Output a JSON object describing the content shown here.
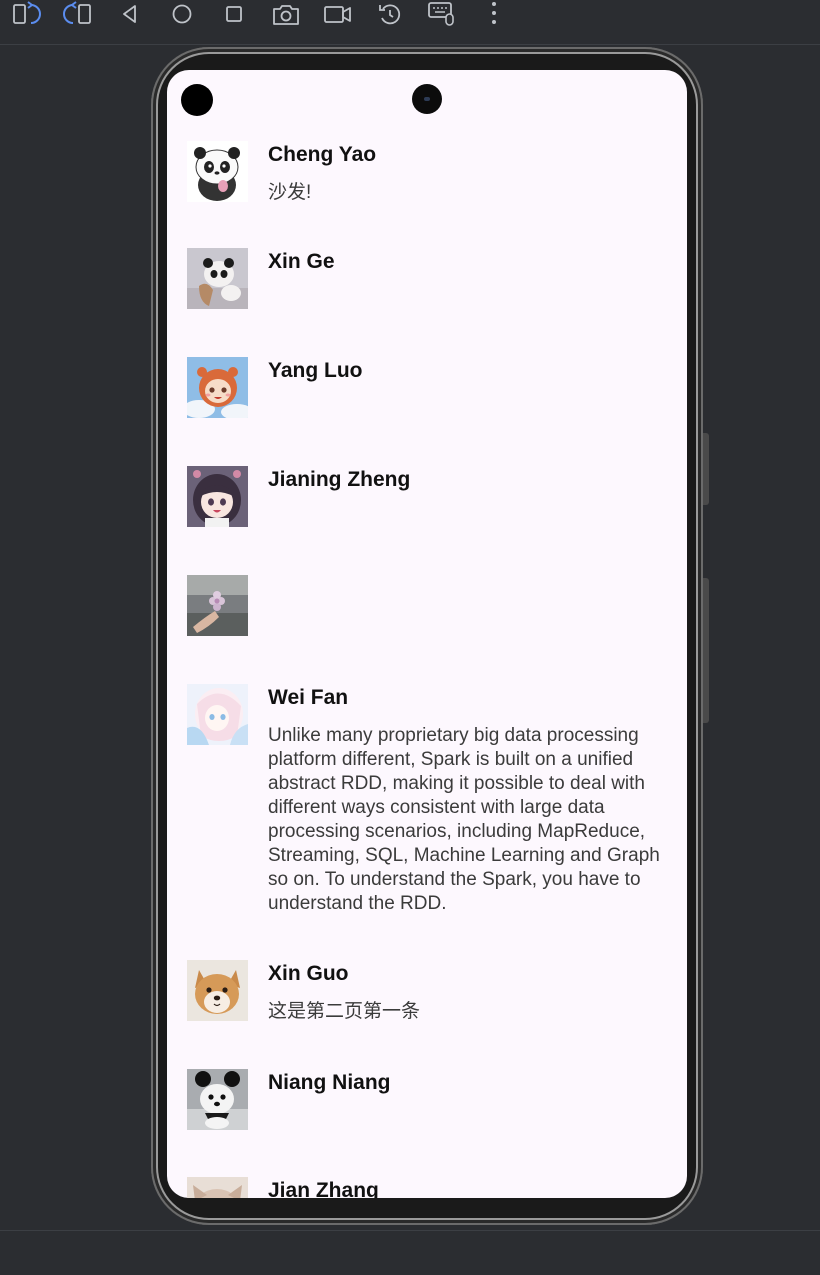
{
  "toolbar": {
    "buttons": [
      {
        "name": "rotate-left-icon"
      },
      {
        "name": "rotate-right-icon"
      },
      {
        "name": "back-icon"
      },
      {
        "name": "home-icon"
      },
      {
        "name": "overview-icon"
      },
      {
        "name": "screenshot-icon"
      },
      {
        "name": "screen-record-icon"
      },
      {
        "name": "snapshot-restore-icon"
      },
      {
        "name": "keyboard-mouse-icon"
      },
      {
        "name": "more-icon"
      }
    ],
    "accent_color": "#5b8def"
  },
  "contacts": [
    {
      "name": "Cheng Yao",
      "message": "沙发!",
      "avatar": "panda-cartoon-avatar"
    },
    {
      "name": "Xin Ge",
      "message": "",
      "avatar": "panda-toy-avatar"
    },
    {
      "name": "Yang Luo",
      "message": "",
      "avatar": "anime-girl-hamster-hood-avatar"
    },
    {
      "name": "Jianing Zheng",
      "message": "",
      "avatar": "anime-girl-dark-hair-avatar"
    },
    {
      "name": "",
      "message": "",
      "avatar": "flower-in-hand-avatar"
    },
    {
      "name": "Wei Fan",
      "message": "Unlike many proprietary big data processing platform different, Spark is built on a unified abstract RDD, making it possible to deal with different ways consistent with large data processing scenarios, including MapReduce, Streaming, SQL, Machine Learning and Graph so on. To understand the Spark, you have to understand the RDD.",
      "avatar": "anime-girl-pastel-avatar"
    },
    {
      "name": "Xin Guo",
      "message": "这是第二页第一条",
      "avatar": "shiba-dog-avatar"
    },
    {
      "name": "Niang Niang",
      "message": "",
      "avatar": "puppy-mouse-ears-avatar"
    },
    {
      "name": "Jian Zhang",
      "message": "",
      "avatar": "cat-avatar"
    }
  ]
}
